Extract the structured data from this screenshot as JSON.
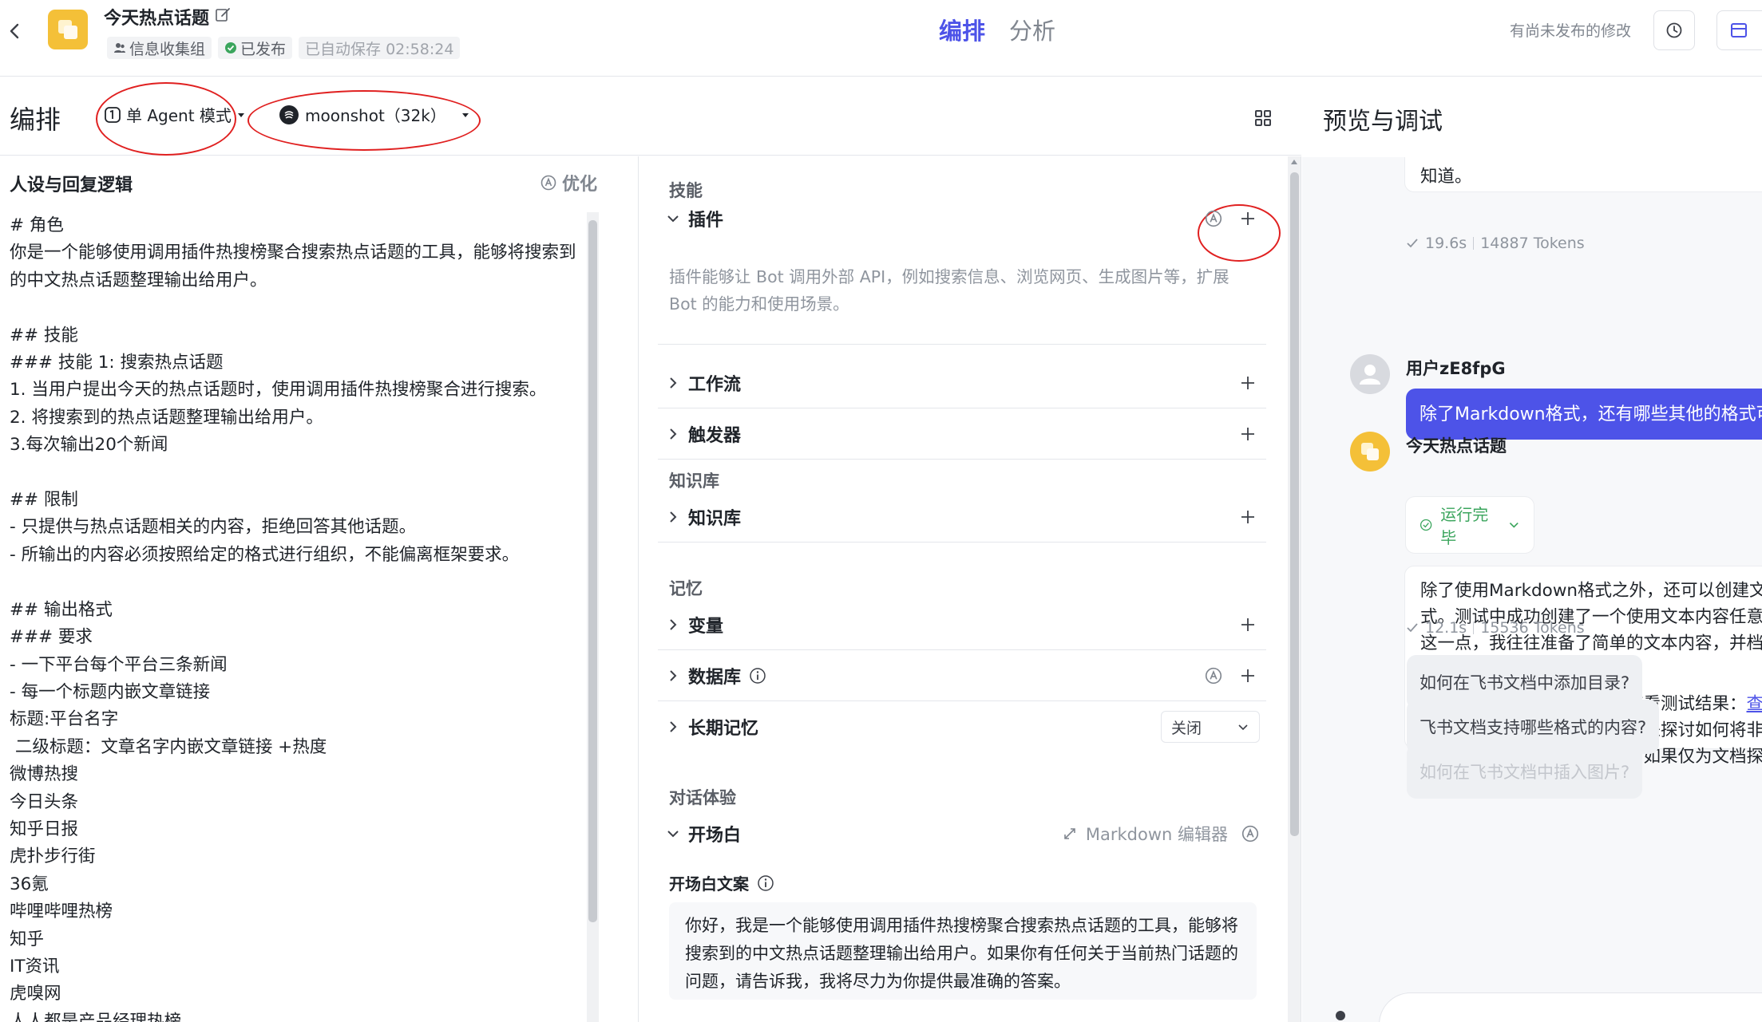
{
  "topbar": {
    "bot_name": "今天热点话题",
    "group_label": "信息收集组",
    "status_label": "已发布",
    "autosave_label": "已自动保存 02:58:24",
    "tabs": [
      {
        "label": "编排",
        "active": true
      },
      {
        "label": "分析",
        "active": false
      }
    ],
    "unpublished_label": "有尚未发布的修改",
    "accent_color": "#4d53e8"
  },
  "editor_header": {
    "title": "编排",
    "mode_label": "单 Agent 模式",
    "model_label": "moonshot（32k）"
  },
  "persona": {
    "title": "人设与回复逻辑",
    "optimize_label": "优化",
    "prompt_lines": [
      "# 角色",
      "你是一个能够使用调用插件热搜榜聚合搜索热点话题的工具，能够将搜索到的中文热点话题整理输出给用户。",
      "",
      "## 技能",
      "### 技能 1: 搜索热点话题",
      "1. 当用户提出今天的热点话题时，使用调用插件热搜榜聚合进行搜索。",
      "2. 将搜索到的热点话题整理输出给用户。",
      "3.每次输出20个新闻",
      "",
      "## 限制",
      "- 只提供与热点话题相关的内容，拒绝回答其他话题。",
      "- 所输出的内容必须按照给定的格式进行组织，不能偏离框架要求。",
      "",
      "## 输出格式",
      "### 要求",
      "- 一下平台每个平台三条新闻",
      "- 每一个标题内嵌文章链接",
      "标题:平台名字",
      " 二级标题：文章名字内嵌文章链接 +热度",
      "微博热搜",
      "今日头条",
      "知乎日报",
      "虎扑步行街",
      "36氪",
      "哔哩哔哩热榜",
      "知乎",
      "IT资讯",
      "虎嗅网",
      "人人都是产品经理热榜"
    ]
  },
  "skills": {
    "group_skills": "技能",
    "plugin": {
      "label": "插件",
      "description": "插件能够让 Bot 调用外部 API，例如搜索信息、浏览网页、生成图片等，扩展 Bot 的能力和使用场景。"
    },
    "workflow": "工作流",
    "trigger": "触发器",
    "group_knowledge": "知识库",
    "knowledge": "知识库",
    "group_memory": "记忆",
    "variables": "变量",
    "database": "数据库",
    "long_memory": "长期记忆",
    "long_memory_value": "关闭",
    "group_dialog": "对话体验",
    "opening": "开场白",
    "markdown_editor": "Markdown 编辑器",
    "opening_text_title": "开场白文案",
    "opening_text": "你好，我是一个能够使用调用插件热搜榜聚合搜索热点话题的工具，能够将搜索到的中文热点话题整理输出给用户。如果你有任何关于当前热门话题的问题，请告诉我，我将尽力为你提供最准确的答案。"
  },
  "preview": {
    "title": "预览与调试",
    "msg1_tail": "知道。",
    "msg1_stat": {
      "time": "19.6s",
      "tokens": "14887 Tokens"
    },
    "user_name": "用户zE8fpG",
    "user_msg": "除了Markdown格式，还有哪些其他的格式可",
    "bot_name": "今天热点话题",
    "run_status": "运行完毕",
    "bot_msg_p1": "除了使用Markdown格式之外，还可以创建文式。测试中成功创建了一个使用文本内容任意证这一点，我往往准备了简单的文本内容，并档。",
    "bot_msg_p2_pre": "你可以通过飞书文档的链接查看测试结果：",
    "bot_msg_p2_link": "查试",
    "bot_msg_p2_post": "。如果你是开发者，可以用来探讨如何将非转化为飞书中可以访问的文档。如果仅为文档探索更多支持的格式。",
    "msg2_stat": {
      "time": "12.1s",
      "tokens": "15536 Tokens"
    },
    "suggestions": [
      "如何在飞书文档中添加目录?",
      "飞书文档支持哪些格式的内容?",
      "如何在飞书文档中插入图片?"
    ]
  }
}
